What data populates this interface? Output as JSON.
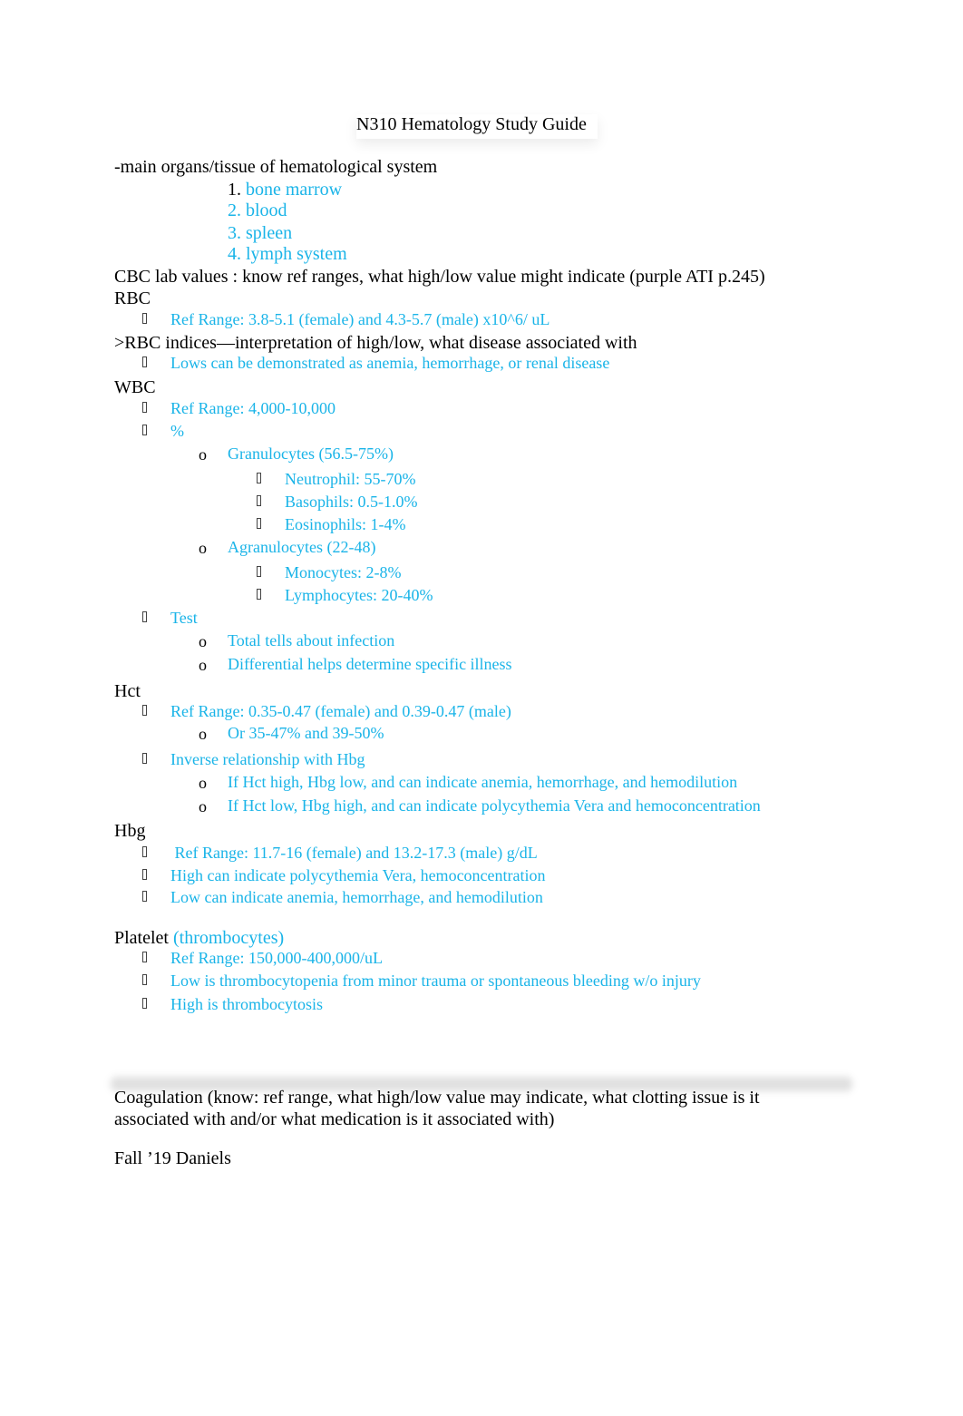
{
  "document": {
    "title": "N310 Hematology Study Guide",
    "organs": {
      "heading": "-main organs/tissue of hematological system",
      "items": [
        {
          "num": "1.",
          "text": "bone marrow"
        },
        {
          "num": "2.",
          "text": "blood"
        },
        {
          "num": "3.",
          "text": "spleen"
        },
        {
          "num": "4.",
          "text": "lymph system"
        }
      ]
    },
    "cbc_heading": "CBC lab values : know ref ranges, what high/low value might indicate (purple ATI p.245)",
    "rbc": {
      "heading": "RBC",
      "ref": "Ref Range: 3.8-5.1 (female) and 4.3-5.7 (male) x10^6/ uL",
      "indices_heading": ">RBC indices—interpretation of high/low, what disease associated with",
      "indices_note": "Lows can be demonstrated as anemia, hemorrhage, or renal disease"
    },
    "wbc": {
      "heading": "WBC",
      "ref": "Ref Range: 4,000-10,000",
      "percent": "%",
      "granulocytes": "Granulocytes (56.5-75%)",
      "granulocyte_items": [
        "Neutrophil: 55-70%",
        "Basophils: 0.5-1.0%",
        "Eosinophils: 1-4%"
      ],
      "agranulocytes": "Agranulocytes (22-48)",
      "agranulocyte_items": [
        "Monocytes: 2-8%",
        "Lymphocytes: 20-40%"
      ],
      "test": "Test",
      "test_items": [
        "Total tells about infection",
        "Differential helps determine specific illness"
      ]
    },
    "hct": {
      "heading": "Hct",
      "ref": "Ref Range: 0.35-0.47 (female) and 0.39-0.47 (male)",
      "ref_alt": "Or 35-47% and 39-50%",
      "inverse": "Inverse relationship with Hbg",
      "inverse_items": [
        "If Hct high, Hbg low, and can indicate anemia, hemorrhage, and hemodilution",
        "If Hct low, Hbg high, and can indicate polycythemia Vera and hemoconcentration"
      ]
    },
    "hbg": {
      "heading": "Hbg",
      "items": [
        " Ref Range: 11.7-16 (female) and 13.2-17.3 (male) g/dL",
        "High can indicate polycythemia Vera, hemoconcentration",
        "Low can indicate anemia, hemorrhage, and hemodilution"
      ]
    },
    "platelet": {
      "heading": "Platelet",
      "heading_note": "(thrombocytes)",
      "items": [
        "Ref Range: 150,000-400,000/uL",
        "Low is thrombocytopenia from minor trauma or spontaneous bleeding w/o injury",
        "High is thrombocytosis"
      ]
    },
    "coagulation": {
      "line1": "Coagulation (know: ref range, what high/low value may indicate, what clotting issue is it",
      "line2": "associated with and/or what medication is it associated with)"
    },
    "footer": "Fall ’19 Daniels",
    "bullets": {
      "level1": "square-bullet",
      "level2": "o",
      "level3": "square-bullet"
    },
    "colors": {
      "answer_text": "#1ab4e8",
      "body_text": "#000000"
    }
  }
}
